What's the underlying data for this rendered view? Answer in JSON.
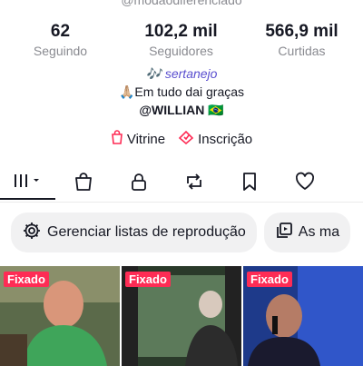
{
  "profile": {
    "handle": "@modaodiferenciado",
    "stats": [
      {
        "value": "62",
        "label": "Seguindo"
      },
      {
        "value": "102,2 mil",
        "label": "Seguidores"
      },
      {
        "value": "566,9 mil",
        "label": "Curtidas"
      }
    ],
    "bio_line1": "🎶 sertanejo",
    "bio_line2": "🙏🏼Em tudo dai graças",
    "bio_line3": "@WILLIAN 🇧🇷"
  },
  "links": {
    "shop_label": "Vitrine",
    "subscribe_label": "Inscrição"
  },
  "tabs": [
    {
      "icon": "grid-icon",
      "active": true
    },
    {
      "icon": "bag-icon"
    },
    {
      "icon": "lock-icon"
    },
    {
      "icon": "repost-icon"
    },
    {
      "icon": "bookmark-icon"
    },
    {
      "icon": "heart-icon"
    }
  ],
  "pills": {
    "playlists_label": "Gerenciar listas de reprodução",
    "collections_label": "As ma"
  },
  "videos": [
    {
      "badge": "Fixado"
    },
    {
      "badge": "Fixado"
    },
    {
      "badge": "Fixado"
    }
  ],
  "colors": {
    "accent": "#fe2c55",
    "muted_text": "#8a8b91",
    "text": "#161823"
  }
}
